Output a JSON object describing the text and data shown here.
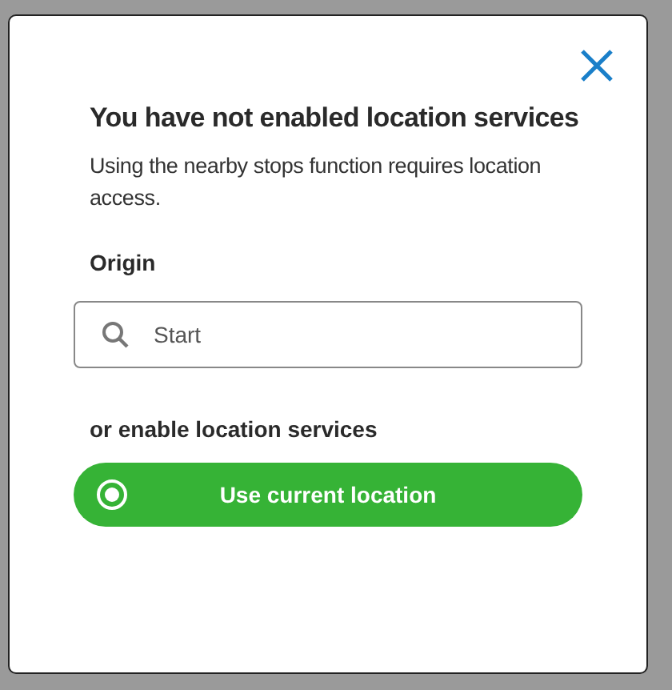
{
  "dialog": {
    "title": "You have not enabled location services",
    "message": "Using the nearby stops function requires location access.",
    "origin": {
      "label": "Origin",
      "placeholder": "Start"
    },
    "alternative_label": "or enable location services",
    "button": {
      "label": "Use current location"
    }
  }
}
